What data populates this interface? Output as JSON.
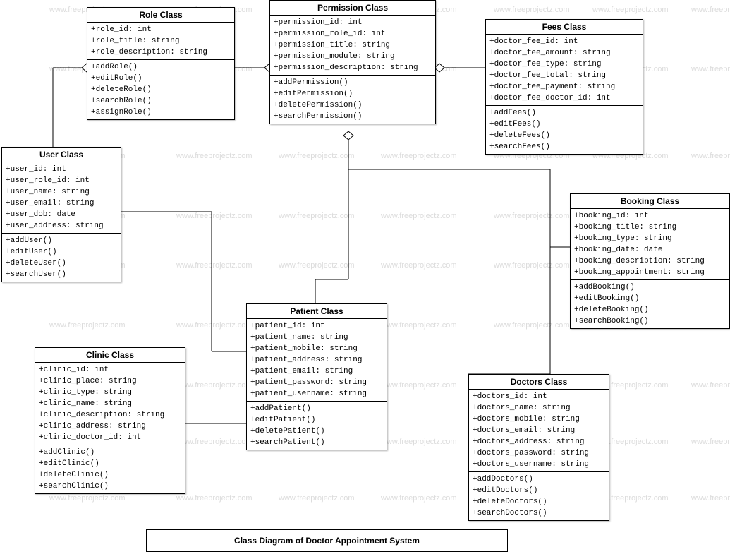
{
  "diagram_title": "Class Diagram of Doctor Appointment System",
  "watermark_text": "www.freeprojectz.com",
  "classes": {
    "role": {
      "name": "Role Class",
      "attrs": [
        "+role_id: int",
        "+role_title: string",
        "+role_description: string"
      ],
      "methods": [
        "+addRole()",
        "+editRole()",
        "+deleteRole()",
        "+searchRole()",
        "+assignRole()"
      ]
    },
    "permission": {
      "name": "Permission Class",
      "attrs": [
        "+permission_id: int",
        "+permission_role_id: int",
        "+permission_title: string",
        "+permission_module: string",
        "+permission_description: string"
      ],
      "methods": [
        "+addPermission()",
        "+editPermission()",
        "+deletePermission()",
        "+searchPermission()"
      ]
    },
    "fees": {
      "name": "Fees Class",
      "attrs": [
        "+doctor_fee_id: int",
        "+doctor_fee_amount: string",
        "+doctor_fee_type: string",
        "+doctor_fee_total: string",
        "+doctor_fee_payment: string",
        "+doctor_fee_doctor_id: int"
      ],
      "methods": [
        "+addFees()",
        "+editFees()",
        "+deleteFees()",
        "+searchFees()"
      ]
    },
    "user": {
      "name": "User Class",
      "attrs": [
        "+user_id: int",
        "+user_role_id: int",
        "+user_name: string",
        "+user_email: string",
        "+user_dob: date",
        "+user_address: string"
      ],
      "methods": [
        "+addUser()",
        "+editUser()",
        "+deleteUser()",
        "+searchUser()"
      ]
    },
    "booking": {
      "name": "Booking Class",
      "attrs": [
        "+booking_id: int",
        "+booking_title: string",
        "+booking_type: string",
        "+booking_date: date",
        "+booking_description: string",
        "+booking_appointment: string"
      ],
      "methods": [
        "+addBooking()",
        "+editBooking()",
        "+deleteBooking()",
        "+searchBooking()"
      ]
    },
    "patient": {
      "name": "Patient Class",
      "attrs": [
        "+patient_id: int",
        "+patient_name: string",
        "+patient_mobile: string",
        "+patient_address: string",
        "+patient_email: string",
        "+patient_password: string",
        "+patient_username: string"
      ],
      "methods": [
        "+addPatient()",
        "+editPatient()",
        "+deletePatient()",
        "+searchPatient()"
      ]
    },
    "clinic": {
      "name": "Clinic Class",
      "attrs": [
        "+clinic_id: int",
        "+clinic_place: string",
        "+clinic_type: string",
        "+clinic_name: string",
        "+clinic_description: string",
        "+clinic_address: string",
        "+clinic_doctor_id: int"
      ],
      "methods": [
        "+addClinic()",
        "+editClinic()",
        "+deleteClinic()",
        "+searchClinic()"
      ]
    },
    "doctors": {
      "name": "Doctors Class",
      "attrs": [
        "+doctors_id: int",
        "+doctors_name: string",
        "+doctors_mobile: string",
        "+doctors_email: string",
        "+doctors_address: string",
        "+doctors_password: string",
        "+doctors_username: string"
      ],
      "methods": [
        "+addDoctors()",
        "+editDoctors()",
        "+deleteDoctors()",
        "+searchDoctors()"
      ]
    }
  }
}
